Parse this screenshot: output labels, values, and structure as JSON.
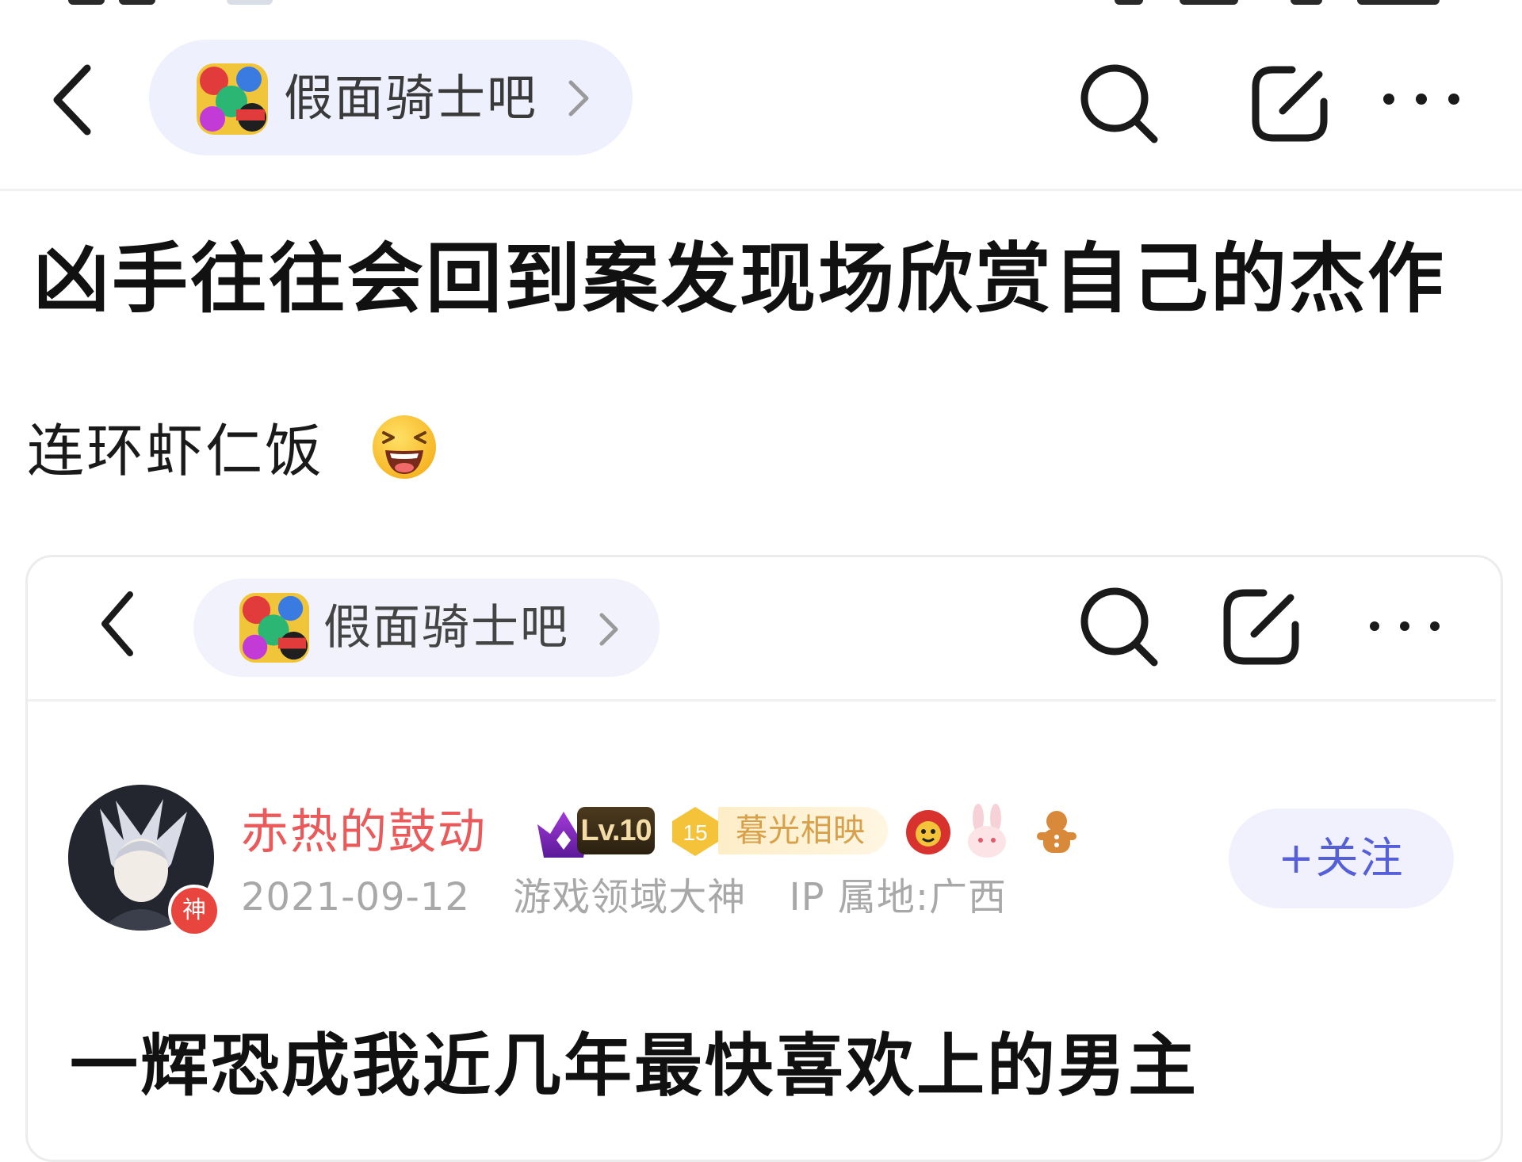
{
  "nav": {
    "forum_name": "假面骑士吧"
  },
  "post": {
    "title": "凶手往往会回到案发现场欣赏自己的杰作",
    "body": "连环虾仁饭",
    "emoji_icon": "laughing-emoji-icon"
  },
  "embedded": {
    "nav": {
      "forum_name": "假面骑士吧"
    },
    "author": {
      "username": "赤热的鼓动",
      "level_badge": "Lv.10",
      "fan_level": "15",
      "title_badge": "暮光相映",
      "date": "2021-09-12",
      "honor": "游戏领域大神",
      "ip_location": "IP 属地:广西",
      "avatar_badge": "神"
    },
    "follow_label": "+关注",
    "title": "一辉恐成我近几年最快喜欢上的男主"
  },
  "colors": {
    "accent": "#5560d8",
    "username": "#ea5a5a",
    "pill_bg": "#eef0fd",
    "meta": "#a8a8a8"
  }
}
